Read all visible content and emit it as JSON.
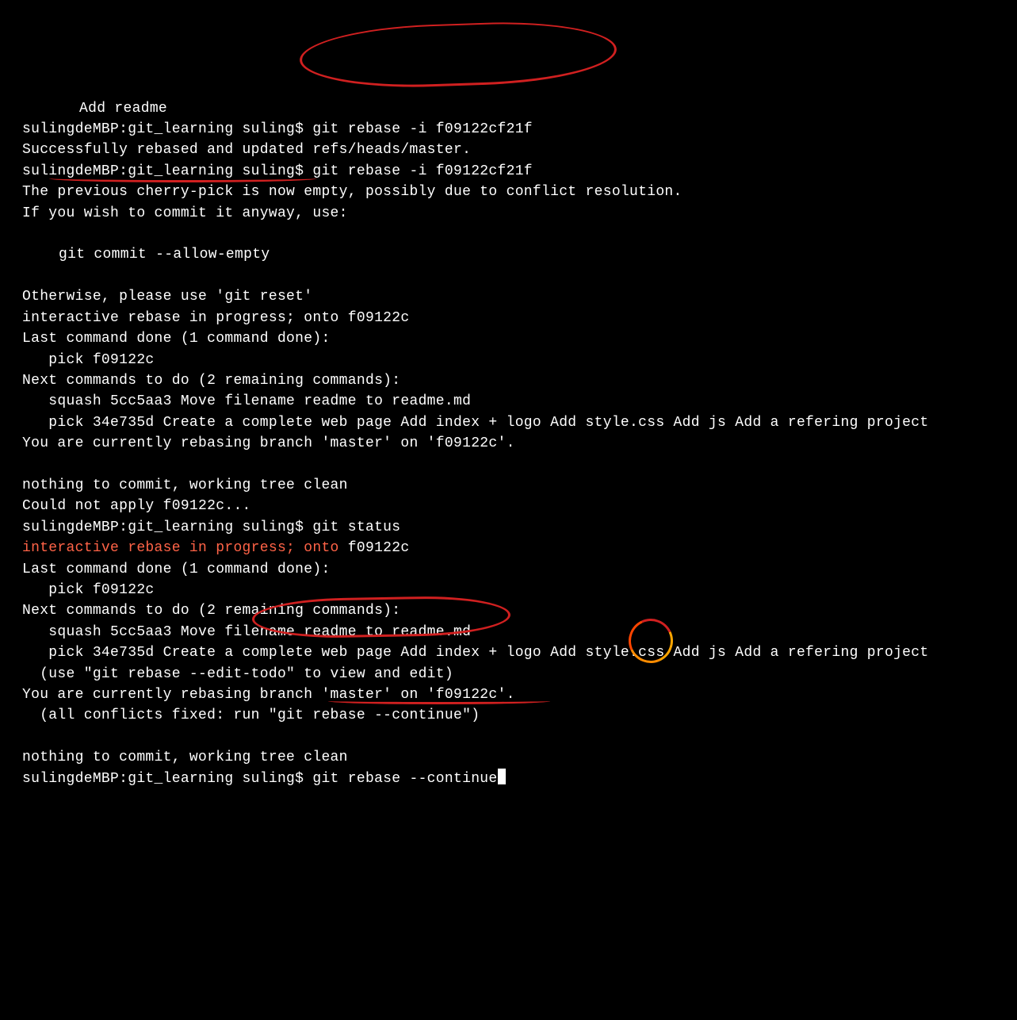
{
  "terminal": {
    "lines": [
      {
        "text": "Add readme",
        "class": "indent-big"
      },
      {
        "text": "sulingdeMBP:git_learning suling$ git rebase -i f09122cf21f"
      },
      {
        "text": "Successfully rebased and updated refs/heads/master."
      },
      {
        "text": "sulingdeMBP:git_learning suling$ git rebase -i f09122cf21f"
      },
      {
        "text": "The previous cherry-pick is now empty, possibly due to conflict resolution."
      },
      {
        "text": "If you wish to commit it anyway, use:"
      },
      {
        "text": " "
      },
      {
        "text": "git commit --allow-empty",
        "class": "indent-sm"
      },
      {
        "text": " "
      },
      {
        "text": "Otherwise, please use 'git reset'"
      },
      {
        "text": "interactive rebase in progress; onto f09122c"
      },
      {
        "text": "Last command done (1 command done):"
      },
      {
        "text": "   pick f09122c"
      },
      {
        "text": "Next commands to do (2 remaining commands):"
      },
      {
        "text": "   squash 5cc5aa3 Move filename readme to readme.md"
      },
      {
        "text": "   pick 34e735d Create a complete web page Add index + logo Add style.css Add js Add a refering project"
      },
      {
        "text": "You are currently rebasing branch 'master' on 'f09122c'."
      },
      {
        "text": " "
      },
      {
        "text": "nothing to commit, working tree clean"
      },
      {
        "text": "Could not apply f09122c..."
      },
      {
        "text": "sulingdeMBP:git_learning suling$ git status"
      },
      {
        "segments": [
          {
            "text": "interactive rebase in progress; onto",
            "color": "red"
          },
          {
            "text": " f09122c"
          }
        ]
      },
      {
        "text": "Last command done (1 command done):"
      },
      {
        "text": "   pick f09122c"
      },
      {
        "text": "Next commands to do (2 remaining commands):"
      },
      {
        "text": "   squash 5cc5aa3 Move filename readme to readme.md"
      },
      {
        "text": "   pick 34e735d Create a complete web page Add index + logo Add style.css Add js Add a refering project"
      },
      {
        "text": "  (use \"git rebase --edit-todo\" to view and edit)"
      },
      {
        "text": "You are currently rebasing branch 'master' on 'f09122c'."
      },
      {
        "text": "  (all conflicts fixed: run \"git rebase --continue\")"
      },
      {
        "text": " "
      },
      {
        "text": "nothing to commit, working tree clean"
      },
      {
        "text": "sulingdeMBP:git_learning suling$ git rebase --continue",
        "cursor": true
      }
    ]
  },
  "annotations": {
    "highlight_color": "#d02020",
    "ring_colors": [
      "#ff4500",
      "#ffa500"
    ]
  }
}
